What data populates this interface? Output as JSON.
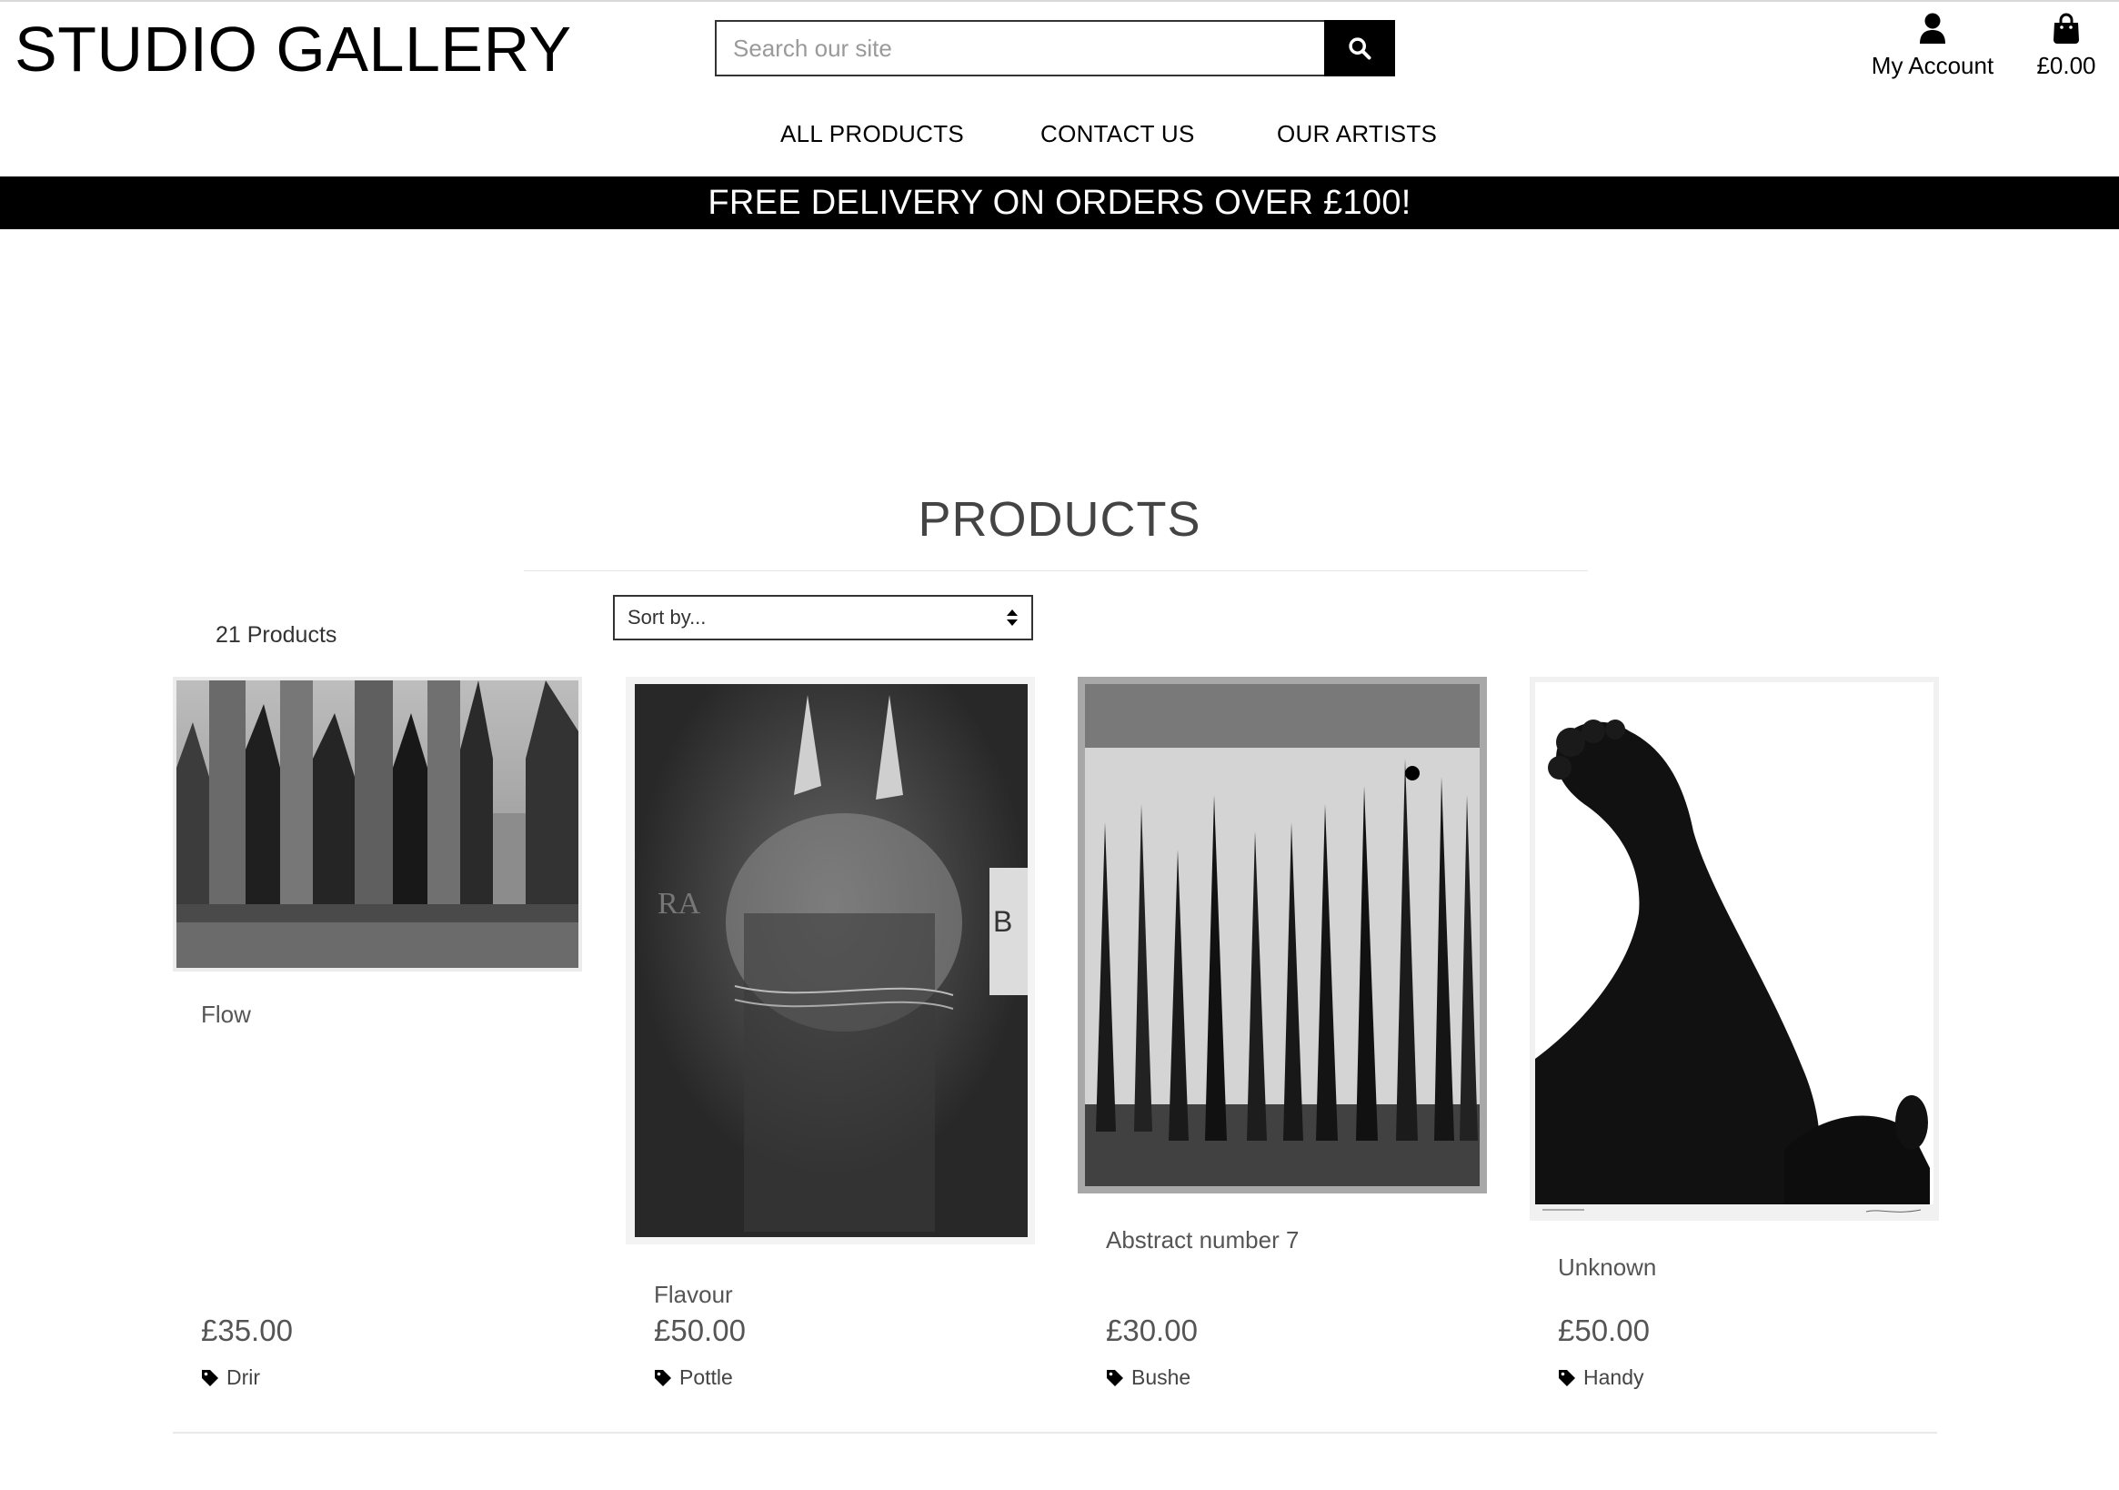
{
  "header": {
    "logo": "STUDIO GALLERY",
    "search_placeholder": "Search our site",
    "account_label": "My Account",
    "basket_total": "£0.00"
  },
  "nav": {
    "items": [
      "ALL PRODUCTS",
      "CONTACT US",
      "OUR ARTISTS"
    ]
  },
  "banner": "FREE DELIVERY ON ORDERS OVER £100!",
  "products": {
    "title": "PRODUCTS",
    "count_label": "21 Products",
    "sort_label": "Sort by...",
    "items": [
      {
        "name": "Flow",
        "price": "£35.00",
        "artist": "Drir"
      },
      {
        "name": "Flavour",
        "price": "£50.00",
        "artist": "Pottle"
      },
      {
        "name": "Abstract number 7",
        "price": "£30.00",
        "artist": "Bushe"
      },
      {
        "name": "Unknown",
        "price": "£50.00",
        "artist": "Handy"
      }
    ]
  },
  "icons": {
    "search": "search-icon",
    "account": "user-icon",
    "basket": "shopping-bag-icon",
    "tag": "tag-icon",
    "sort": "sort-arrows-icon"
  },
  "colors": {
    "banner_bg": "#000000",
    "banner_text": "#ffffff",
    "text_muted": "#555555"
  }
}
